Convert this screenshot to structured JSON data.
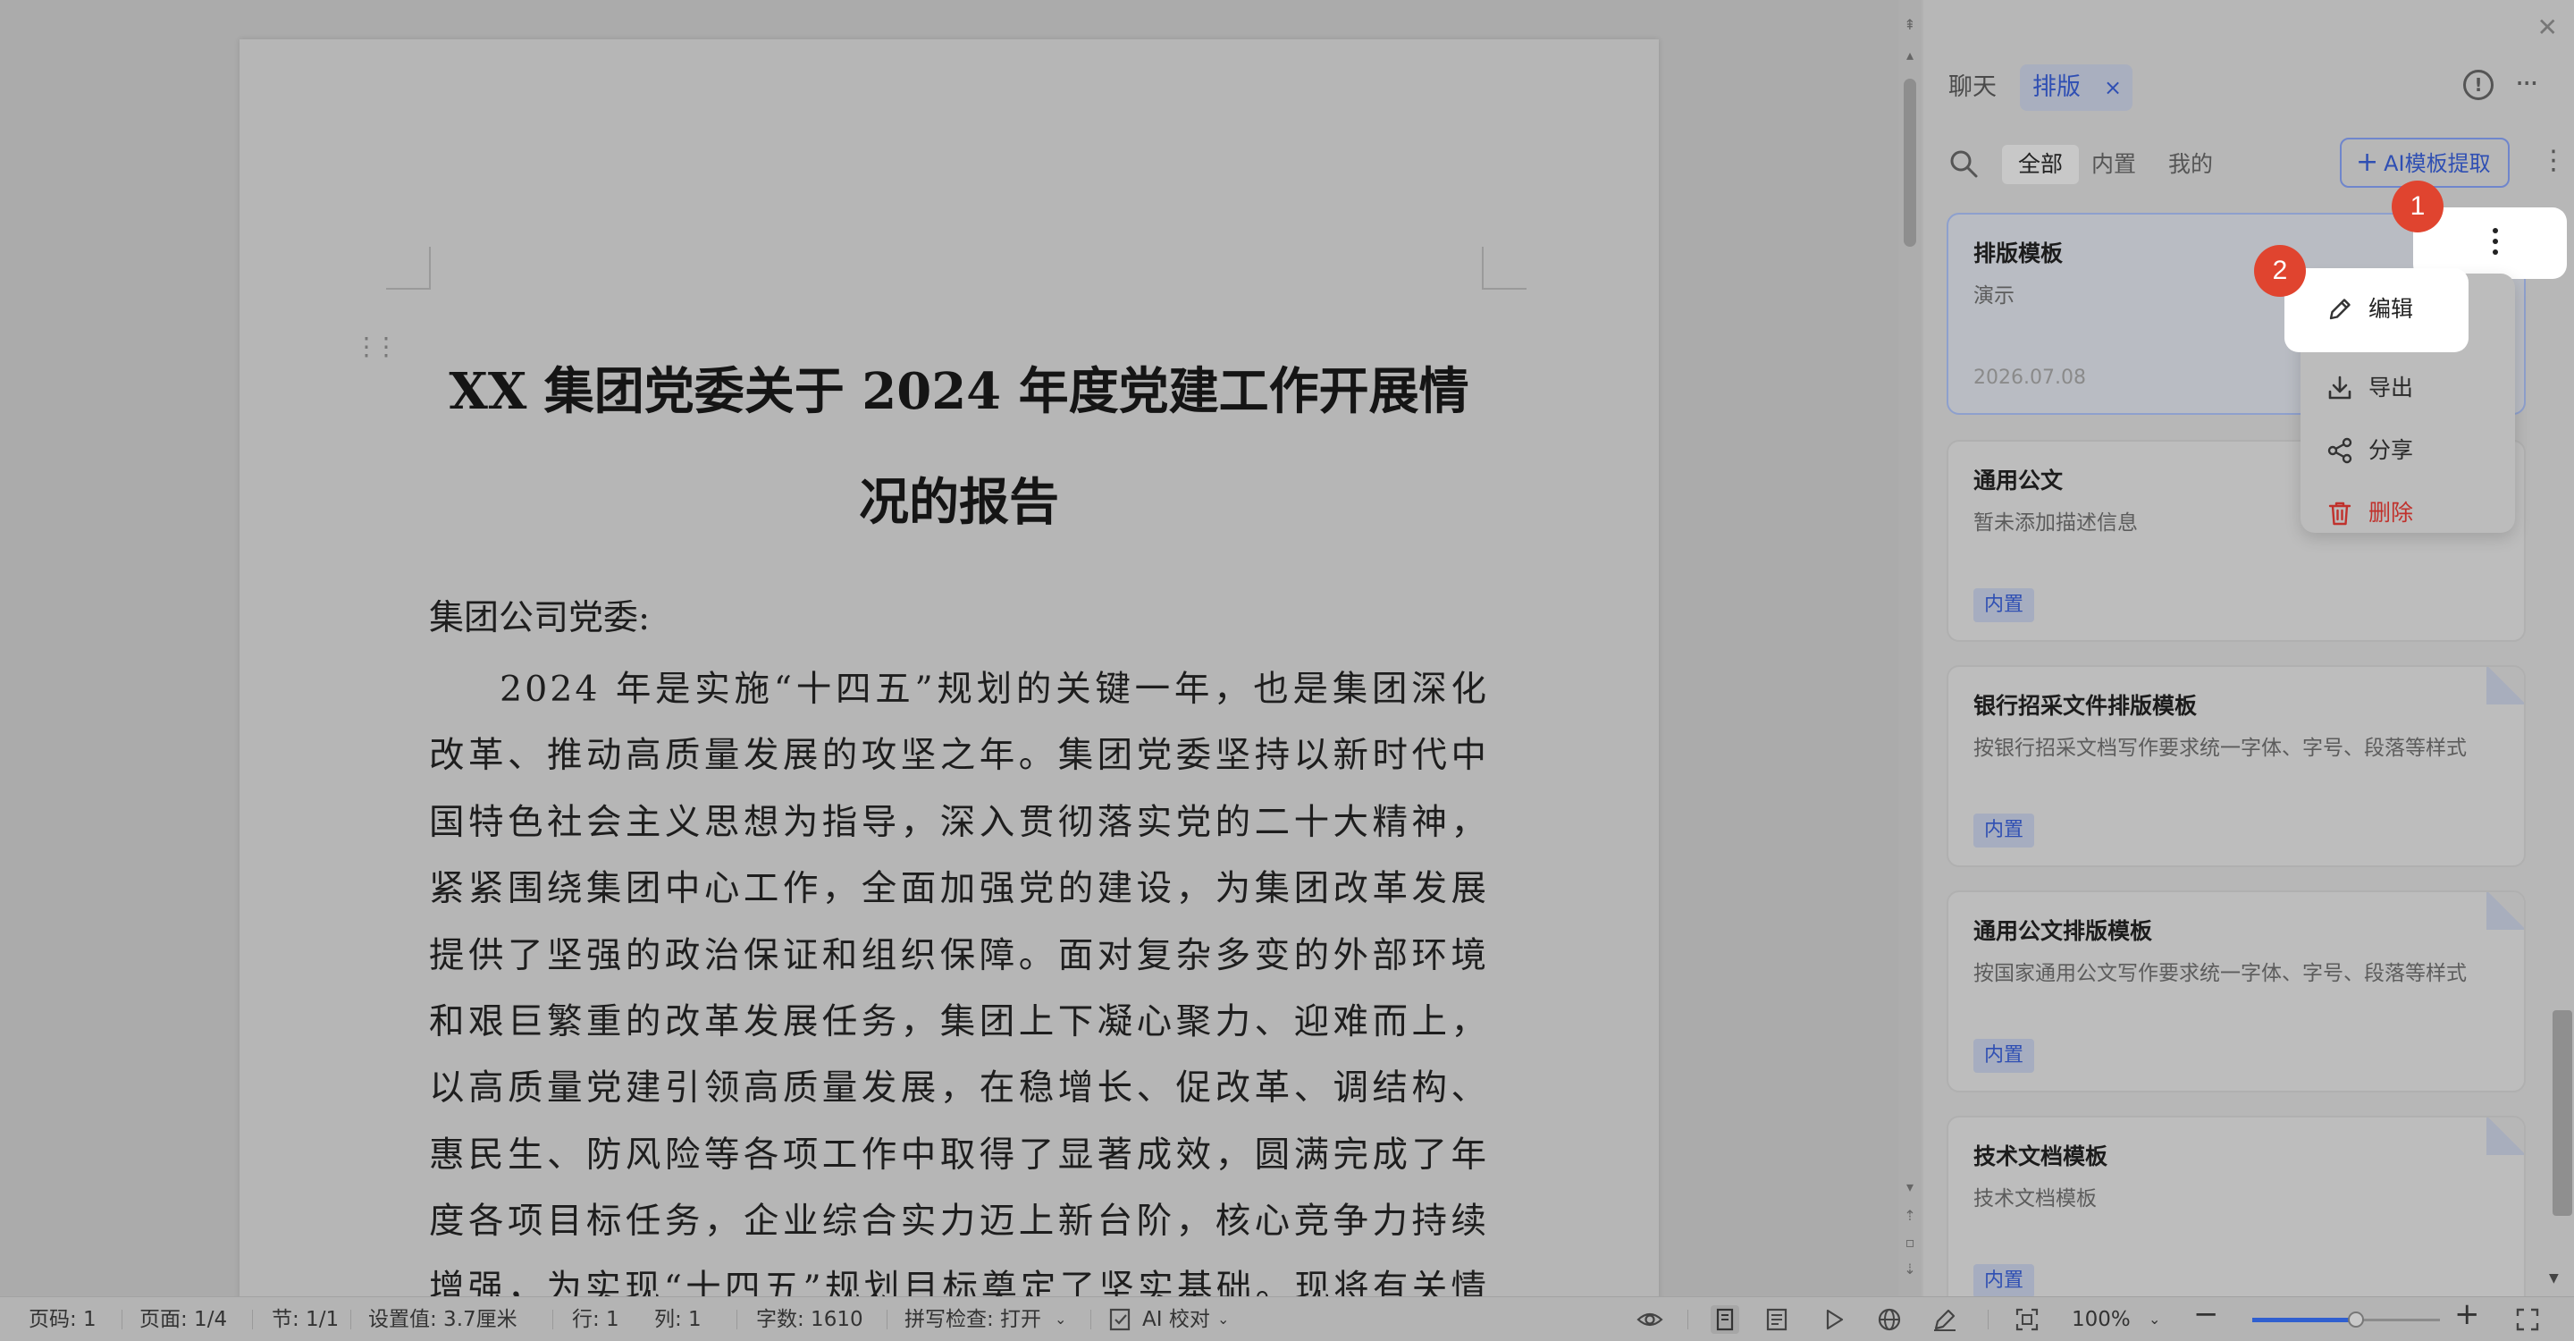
{
  "document": {
    "title": "XX 集团党委关于 2024 年度党建工作开展情况的报告",
    "salutation": "集团公司党委:",
    "body": "2024 年是实施“十四五”规划的关键一年，也是集团深化改革、推动高质量发展的攻坚之年。集团党委坚持以新时代中国特色社会主义思想为指导，深入贯彻落实党的二十大精神，紧紧围绕集团中心工作，全面加强党的建设，为集团改革发展提供了坚强的政治保证和组织保障。面对复杂多变的外部环境和艰巨繁重的改革发展任务，集团上下凝心聚力、迎难而上，以高质量党建引领高质量发展，在稳增长、促改革、调结构、惠民生、防风险等各项工作中取得了显著成效，圆满完成了年度各项目标任务，企业综合实力迈上新台阶，核心竞争力持续增强，为实现“十四五”规划目标奠定了坚实基础。现将有关情况报告如下:"
  },
  "panel": {
    "tab_chat": "聊天",
    "tab_layout": "排版",
    "tab_close": "×",
    "filters": {
      "all": "全部",
      "builtin": "内置",
      "mine": "我的"
    },
    "ai_button": "AI模板提取",
    "ai_button_plus": "+",
    "cards": [
      {
        "title": "排版模板",
        "desc": "演示",
        "date": "2026.07.08"
      },
      {
        "title": "通用公文",
        "desc": "暂未添加描述信息",
        "badge": "内置"
      },
      {
        "title": "银行招采文件排版模板",
        "desc": "按银行招采文档写作要求统一字体、字号、段落等样式",
        "badge": "内置"
      },
      {
        "title": "通用公文排版模板",
        "desc": "按国家通用公文写作要求统一字体、字号、段落等样式",
        "badge": "内置"
      },
      {
        "title": "技术文档模板",
        "desc": "技术文档模板",
        "badge": "内置"
      }
    ],
    "context_menu": {
      "edit": "编辑",
      "export": "导出",
      "share": "分享",
      "delete": "删除"
    },
    "callouts": [
      "1",
      "2"
    ]
  },
  "statusbar": {
    "page_number": "页码: 1",
    "pages": "页面: 1/4",
    "section": "节: 1/1",
    "setting": "设置值: 3.7厘米",
    "row": "行: 1",
    "col": "列: 1",
    "word_count": "字数: 1610",
    "spellcheck": "拼写检查: 打开",
    "ai_proofread": "AI 校对",
    "zoom": "100%",
    "zoom_level": 0.55
  },
  "colors": {
    "accent": "#2f4fb3",
    "callout": "#e0442f",
    "danger": "#c0312c"
  }
}
